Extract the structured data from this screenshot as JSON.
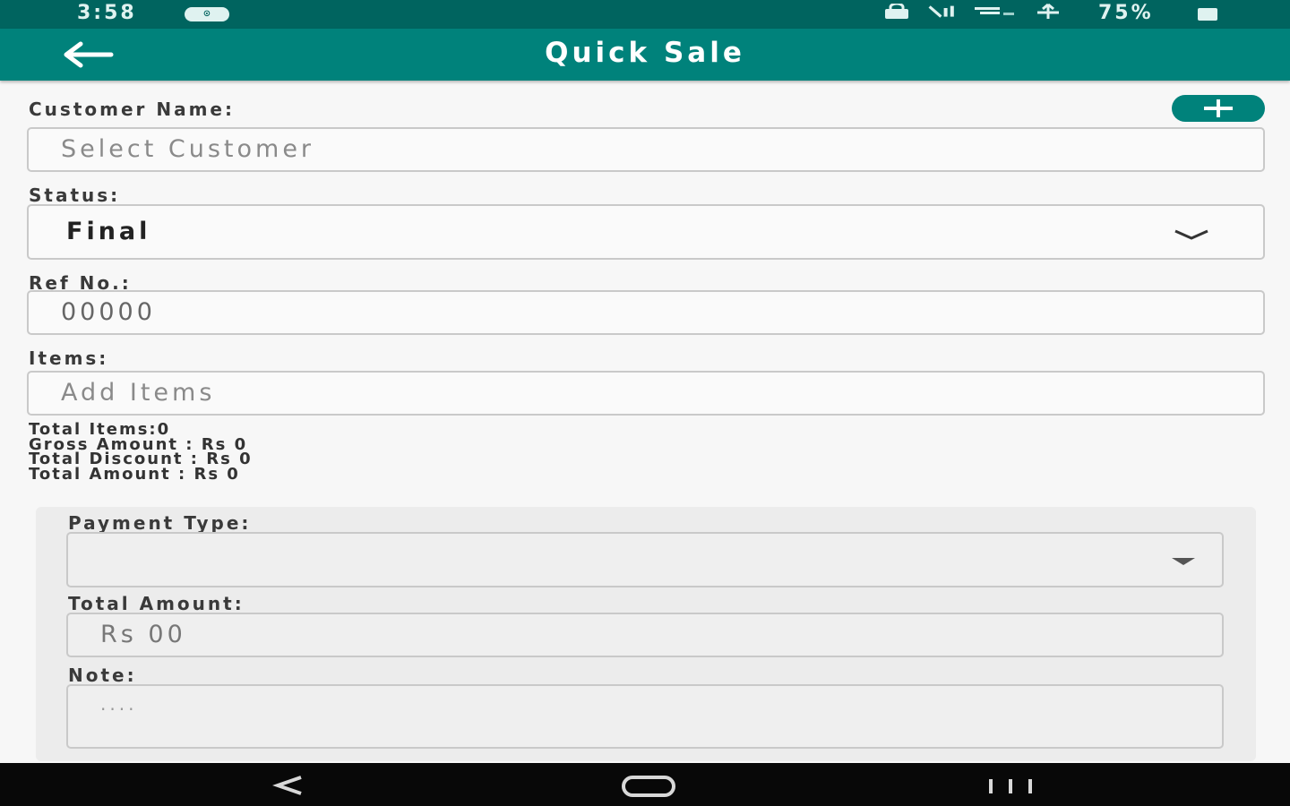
{
  "status_bar": {
    "time": "3:58",
    "pill": "⊙",
    "battery": "75%",
    "icons": [
      "lock-icon",
      "signal-icon",
      "wifi-icon",
      "data-transfer-icon",
      "battery-icon"
    ]
  },
  "app_bar": {
    "title": "Quick Sale",
    "back_icon": "arrow-left-icon"
  },
  "form": {
    "customer_label": "Customer Name:",
    "customer_placeholder": "Select Customer",
    "add_customer_icon": "plus-icon",
    "status_label": "Status:",
    "status_value": "Final",
    "ref_label": "Ref No.:",
    "ref_value": "00000",
    "items_label": "Items:",
    "items_placeholder": "Add Items"
  },
  "summary": {
    "total_items": "Total Items:0",
    "gross_amount": "Gross Amount : Rs 0",
    "total_discount": "Total Discount : Rs 0",
    "total_amount": "Total Amount : Rs 0"
  },
  "payment": {
    "type_label": "Payment Type:",
    "type_value": "",
    "amount_label": "Total Amount:",
    "amount_value": "Rs 00",
    "note_label": "Note:",
    "note_placeholder": "...."
  },
  "nav_bar": {
    "back_icon": "nav-back-icon",
    "home_icon": "nav-home-icon",
    "recents_icon": "nav-recents-icon"
  },
  "colors": {
    "status_bar": "#00645f",
    "app_bar": "#00827b",
    "accent": "#00827b",
    "background": "#f7f7f7",
    "nav_bar": "#080808"
  }
}
